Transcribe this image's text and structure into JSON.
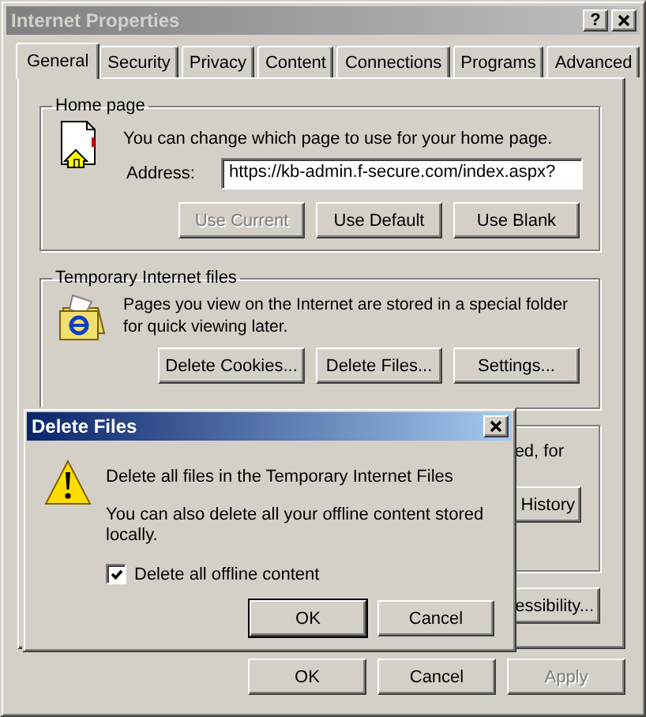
{
  "window": {
    "title": "Internet Properties",
    "active": false,
    "help_button": "?"
  },
  "tabs": [
    {
      "label": "General",
      "selected": true
    },
    {
      "label": "Security",
      "selected": false
    },
    {
      "label": "Privacy",
      "selected": false
    },
    {
      "label": "Content",
      "selected": false
    },
    {
      "label": "Connections",
      "selected": false
    },
    {
      "label": "Programs",
      "selected": false
    },
    {
      "label": "Advanced",
      "selected": false
    }
  ],
  "home_page": {
    "title": "Home page",
    "description": "You can change which page to use for your home page.",
    "address_label": "Address:",
    "address_value": "https://kb-admin.f-secure.com/index.aspx?",
    "buttons": [
      {
        "label": "Use Current",
        "disabled": true
      },
      {
        "label": "Use Default",
        "disabled": false
      },
      {
        "label": "Use Blank",
        "disabled": false
      }
    ]
  },
  "temporary_files": {
    "title": "Temporary Internet files",
    "description": "Pages you view on the Internet are stored in a special folder for quick viewing later.",
    "buttons": [
      {
        "label": "Delete Cookies...",
        "disabled": false
      },
      {
        "label": "Delete Files...",
        "disabled": false
      },
      {
        "label": "Settings...",
        "disabled": false
      }
    ]
  },
  "history": {
    "description": "ed, for",
    "button": "History"
  },
  "accessibility_button": "essibility...",
  "footer_buttons": [
    {
      "label": "OK",
      "disabled": false
    },
    {
      "label": "Cancel",
      "disabled": false
    },
    {
      "label": "Apply",
      "disabled": true
    }
  ],
  "dialog": {
    "title": "Delete Files",
    "active": true,
    "message": "Delete all files in the Temporary Internet Files",
    "detail": "You can also delete all your offline content stored locally.",
    "checkbox": {
      "label": "Delete all offline content",
      "checked": true
    },
    "buttons": [
      {
        "label": "OK",
        "default": true
      },
      {
        "label": "Cancel",
        "default": false
      }
    ]
  }
}
